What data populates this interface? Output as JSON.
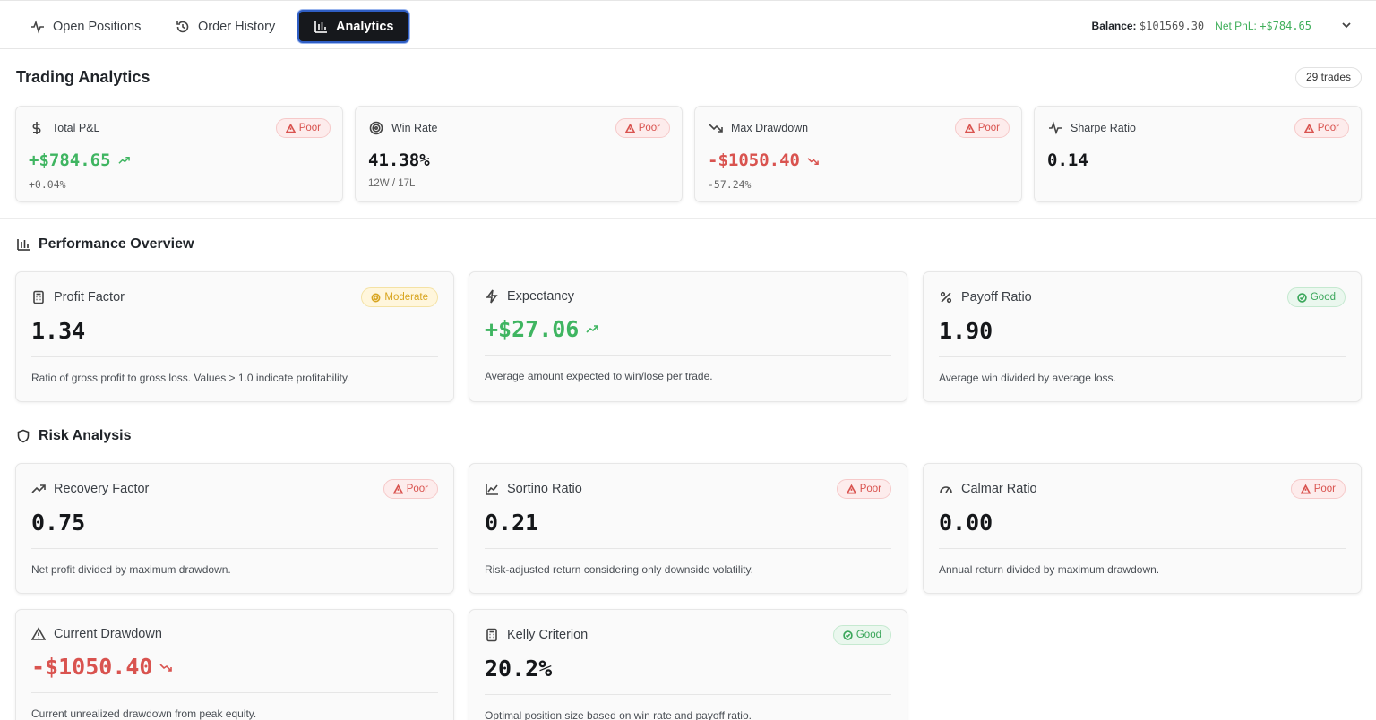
{
  "tabs": [
    {
      "label": "Open Positions",
      "icon": "activity-icon"
    },
    {
      "label": "Order History",
      "icon": "history-icon"
    },
    {
      "label": "Analytics",
      "icon": "bar-chart-icon",
      "active": true
    }
  ],
  "account": {
    "balance_label": "Balance:",
    "balance_value": "$101569.30",
    "pnl_label": "Net PnL:",
    "pnl_value": "+$784.65"
  },
  "page": {
    "title": "Trading Analytics",
    "trades_count": "29 trades"
  },
  "summary_cards": [
    {
      "title": "Total P&L",
      "badge": "Poor",
      "value": "+$784.65",
      "sub": "+0.04%"
    },
    {
      "title": "Win Rate",
      "badge": "Poor",
      "value": "41.38%",
      "sub": "12W / 17L"
    },
    {
      "title": "Max Drawdown",
      "badge": "Poor",
      "value": "-$1050.40",
      "sub": "-57.24%"
    },
    {
      "title": "Sharpe Ratio",
      "badge": "Poor",
      "value": "0.14"
    }
  ],
  "performance": {
    "title": "Performance Overview",
    "cards": [
      {
        "title": "Profit Factor",
        "badge": "Moderate",
        "value": "1.34",
        "desc": "Ratio of gross profit to gross loss. Values > 1.0 indicate profitability."
      },
      {
        "title": "Expectancy",
        "value": "+$27.06",
        "desc": "Average amount expected to win/lose per trade."
      },
      {
        "title": "Payoff Ratio",
        "badge": "Good",
        "value": "1.90",
        "desc": "Average win divided by average loss."
      }
    ]
  },
  "risk": {
    "title": "Risk Analysis",
    "cards": [
      {
        "title": "Recovery Factor",
        "badge": "Poor",
        "value": "0.75",
        "desc": "Net profit divided by maximum drawdown."
      },
      {
        "title": "Sortino Ratio",
        "badge": "Poor",
        "value": "0.21",
        "desc": "Risk-adjusted return considering only downside volatility."
      },
      {
        "title": "Calmar Ratio",
        "badge": "Poor",
        "value": "0.00",
        "desc": "Annual return divided by maximum drawdown."
      },
      {
        "title": "Current Drawdown",
        "value": "-$1050.40",
        "desc": "Current unrealized drawdown from peak equity."
      },
      {
        "title": "Kelly Criterion",
        "badge": "Good",
        "value": "20.2%",
        "desc": "Optimal position size based on win rate and payoff ratio."
      }
    ]
  },
  "colors": {
    "positive": "#3fb561",
    "negative": "#d9534f",
    "moderate": "#d8a520",
    "accent": "#2f5ec4"
  }
}
